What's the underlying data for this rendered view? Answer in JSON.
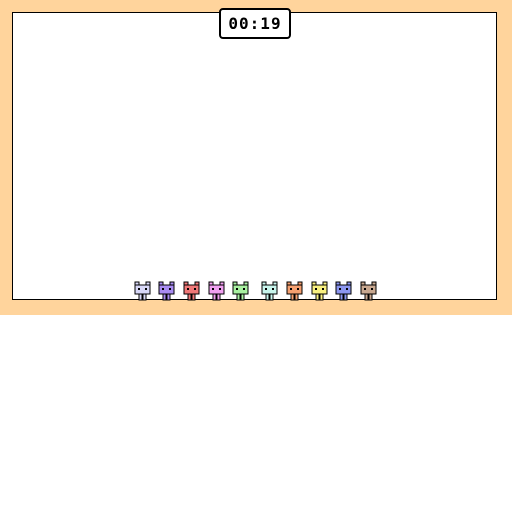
{
  "timer": {
    "text": "00:19"
  },
  "colors": {
    "frame": "#ffd49c",
    "field": "#ffffff",
    "outline": "#000000"
  },
  "players": [
    {
      "name": "cat-lavender",
      "color": "#d8d8f8"
    },
    {
      "name": "cat-purple",
      "color": "#a98cf2"
    },
    {
      "name": "cat-red",
      "color": "#f07878"
    },
    {
      "name": "cat-pink",
      "color": "#f0a0f0"
    },
    {
      "name": "cat-green",
      "color": "#a8f0a0"
    },
    {
      "name": "cat-mint",
      "color": "#c8f5ec"
    },
    {
      "name": "cat-orange",
      "color": "#f5a070"
    },
    {
      "name": "cat-yellow",
      "color": "#f8f080"
    },
    {
      "name": "cat-blue",
      "color": "#8c96f0"
    },
    {
      "name": "cat-tan",
      "color": "#c8a890"
    }
  ]
}
